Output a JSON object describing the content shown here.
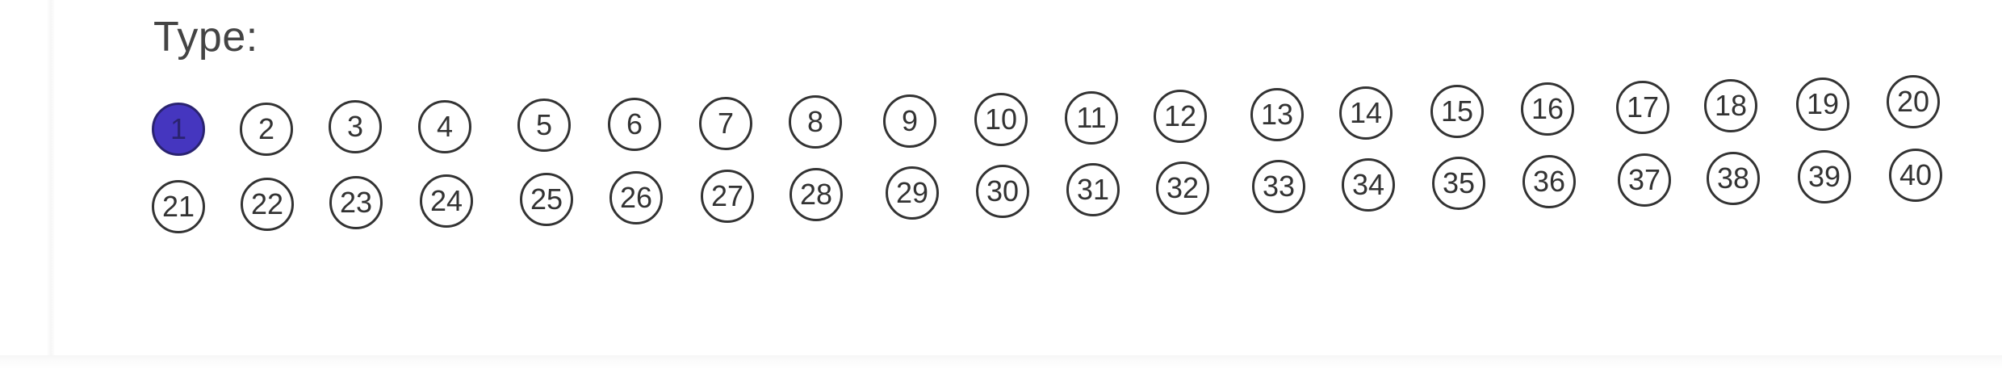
{
  "form": {
    "type_label": "Type:",
    "selected": "1",
    "fill_color": "#4536bf",
    "bubbles": [
      "1",
      "2",
      "3",
      "4",
      "5",
      "6",
      "7",
      "8",
      "9",
      "10",
      "11",
      "12",
      "13",
      "14",
      "15",
      "16",
      "17",
      "18",
      "19",
      "20",
      "21",
      "22",
      "23",
      "24",
      "25",
      "26",
      "27",
      "28",
      "29",
      "30",
      "31",
      "32",
      "33",
      "34",
      "35",
      "36",
      "37",
      "38",
      "39",
      "40"
    ]
  }
}
